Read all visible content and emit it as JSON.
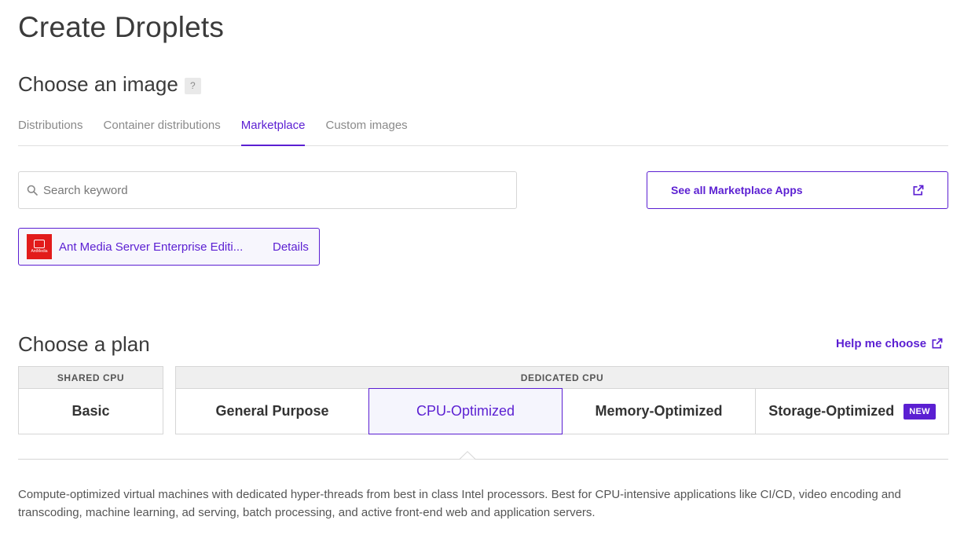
{
  "page": {
    "title": "Create Droplets"
  },
  "image_section": {
    "title": "Choose an image",
    "help_label": "?",
    "tabs": [
      {
        "label": "Distributions",
        "active": false
      },
      {
        "label": "Container distributions",
        "active": false
      },
      {
        "label": "Marketplace",
        "active": true
      },
      {
        "label": "Custom images",
        "active": false
      }
    ],
    "search": {
      "placeholder": "Search keyword",
      "value": ""
    },
    "see_all_label": "See all Marketplace Apps",
    "selected_app": {
      "logo_text": "AntMedia",
      "name": "Ant Media Server Enterprise Editi...",
      "details_label": "Details"
    }
  },
  "plan_section": {
    "title": "Choose a plan",
    "help_label": "Help me choose",
    "shared": {
      "header": "SHARED CPU",
      "options": [
        {
          "label": "Basic"
        }
      ]
    },
    "dedicated": {
      "header": "DEDICATED CPU",
      "options": [
        {
          "label": "General Purpose"
        },
        {
          "label": "CPU-Optimized",
          "selected": true
        },
        {
          "label": "Memory-Optimized"
        },
        {
          "label": "Storage-Optimized",
          "badge": "NEW"
        }
      ]
    },
    "description": "Compute-optimized virtual machines with dedicated hyper-threads from best in class Intel processors. Best for CPU-intensive applications like CI/CD, video encoding and transcoding, machine learning, ad serving, batch processing, and active front-end web and application servers."
  },
  "colors": {
    "accent": "#5b1fd2",
    "logo_red": "#e21b1b"
  },
  "icons": {
    "search": "search-icon",
    "external": "external-link-icon"
  }
}
